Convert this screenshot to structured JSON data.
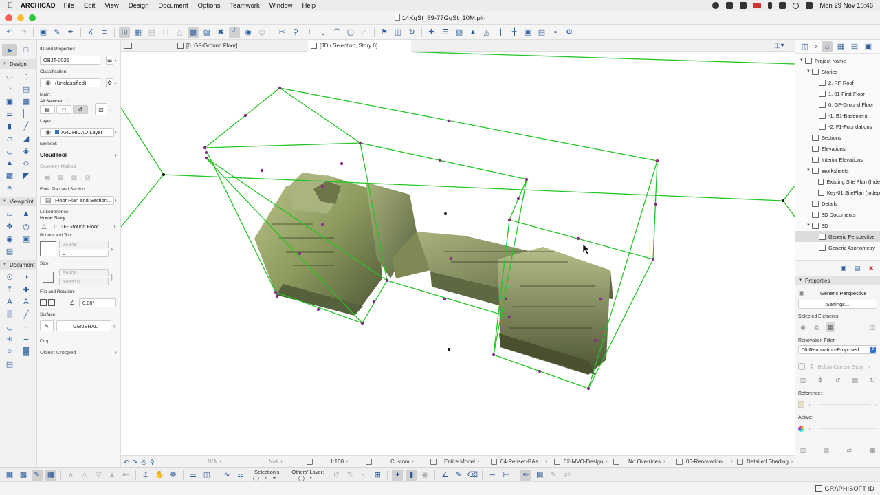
{
  "menubar": {
    "app_name": "ARCHICAD",
    "menus": [
      "File",
      "Edit",
      "View",
      "Design",
      "Document",
      "Options",
      "Teamwork",
      "Window",
      "Help"
    ],
    "clock": "Mon 29 Nov  18:46"
  },
  "window": {
    "title": "14KgSt_69-77GgSt_10M.pln"
  },
  "tabs": [
    {
      "label": "[0. GF-Ground Floor]"
    },
    {
      "label": "[3D / Selection, Story 0]"
    }
  ],
  "toolbox": {
    "design_label": "Design",
    "viewpoint_label": "Viewpoint",
    "document_label": "Document"
  },
  "infobox": {
    "id_label": "ID and Properties:",
    "id_value": "OBJT-0025",
    "classification_label": "Classification:",
    "classification_value": "(Unclassified)",
    "main_label": "Main:",
    "all_selected": "All Selected: 1",
    "layer_label": "Layer:",
    "layer_value": "ARCHICAD Layer",
    "element_label": "Element:",
    "element_value": "CloudTool",
    "geometry_label": "Geometry Method:",
    "floorplan_label": "Floor Plan and Section:",
    "floorplan_value": "Floor Plan and Section...",
    "linked_label": "Linked Stories:",
    "home_story_label": "Home Story:",
    "home_story_value": "0. GF-Ground Floor",
    "bottom_top_label": "Bottom and Top:",
    "top_value": "35849",
    "bottom_value": "0",
    "size_label": "Size:",
    "size_x": "99406",
    "size_y": "168315",
    "flip_label": "Flip and Rotation:",
    "rotation_value": "0.00°",
    "surface_label": "Surface:",
    "surface_value": "GENERAL",
    "crop_label": "Crop:",
    "crop_value": "Object Cropped"
  },
  "statusbar": {
    "na1": "N/A",
    "na2": "N/A",
    "scale": "1:100",
    "custom": "Custom",
    "model": "Entire Model",
    "pen_set": "04-Penset-GAs...",
    "mvo": "02-MVO-Design",
    "overrides": "No Overrides",
    "renovation": "06-Renovation-...",
    "shading": "Detailed Shading"
  },
  "bottombar": {
    "selections_label": "Selection's",
    "others_layer_label": "Others' Layer:"
  },
  "footer": {
    "graphisoft": "GRAPHISOFT ID"
  },
  "navigator": {
    "items": [
      {
        "label": "Project Name",
        "indent": 0,
        "tri": "▼"
      },
      {
        "label": "Stories",
        "indent": 1,
        "tri": "▼"
      },
      {
        "label": "2. RF-Roof",
        "indent": 2,
        "tri": ""
      },
      {
        "label": "1. 01-First Floor",
        "indent": 2,
        "tri": ""
      },
      {
        "label": "0. GF-Ground Floor",
        "indent": 2,
        "tri": ""
      },
      {
        "label": "-1. B1-Basement",
        "indent": 2,
        "tri": ""
      },
      {
        "label": "-2. F1-Foundations",
        "indent": 2,
        "tri": ""
      },
      {
        "label": "Sections",
        "indent": 1,
        "tri": ""
      },
      {
        "label": "Elevations",
        "indent": 1,
        "tri": ""
      },
      {
        "label": "Interior Elevations",
        "indent": 1,
        "tri": ""
      },
      {
        "label": "Worksheets",
        "indent": 1,
        "tri": "▼"
      },
      {
        "label": "Existing Site Plan (Inde",
        "indent": 2,
        "tri": ""
      },
      {
        "label": "Key-01 SitePlan (Indep",
        "indent": 2,
        "tri": ""
      },
      {
        "label": "Details",
        "indent": 1,
        "tri": ""
      },
      {
        "label": "3D Documents",
        "indent": 1,
        "tri": ""
      },
      {
        "label": "3D",
        "indent": 1,
        "tri": "▼"
      },
      {
        "label": "Generic Perspective",
        "indent": 2,
        "tri": "",
        "selected": true
      },
      {
        "label": "Generic Axonometry",
        "indent": 2,
        "tri": ""
      }
    ]
  },
  "rprops": {
    "properties_label": "Properties",
    "view_name": "Generic Perspective",
    "settings_label": "Settings...",
    "selected_elements_label": "Selected Elements:",
    "renovation_filter_label": "Renovation Filter:",
    "renovation_filter_value": "06-Renovation-Proposed",
    "below_story": "Below Current Story",
    "reference_label": "Reference:",
    "active_label": "Active:"
  },
  "colors": {
    "accent": "#2c5d9a",
    "selection_green": "#22c622",
    "hotspot": "#8a2a8a"
  }
}
